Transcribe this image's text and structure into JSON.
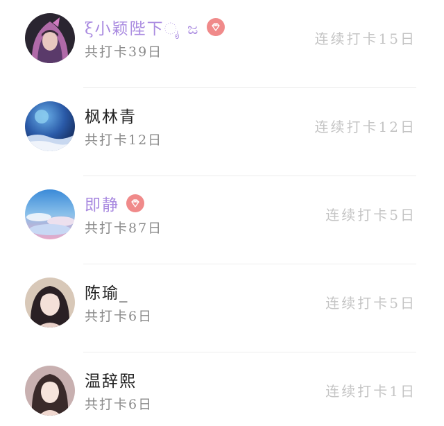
{
  "checkin_list": {
    "members": [
      {
        "name": "ξ小颖陛下ೖ ಜ",
        "vip": true,
        "total_checkin": "共打卡39日",
        "streak": "连续打卡15日",
        "avatar_icon": "avatar-hooded-girl"
      },
      {
        "name": "枫林青",
        "vip": false,
        "total_checkin": "共打卡12日",
        "streak": "连续打卡12日",
        "avatar_icon": "avatar-planet-night"
      },
      {
        "name": "即静",
        "vip": true,
        "total_checkin": "共打卡87日",
        "streak": "连续打卡5日",
        "avatar_icon": "avatar-sky-clouds"
      },
      {
        "name": "陈瑜_",
        "vip": false,
        "total_checkin": "共打卡6日",
        "streak": "连续打卡5日",
        "avatar_icon": "avatar-girl-portrait"
      },
      {
        "name": "温辞熙",
        "vip": false,
        "total_checkin": "共打卡6日",
        "streak": "连续打卡1日",
        "avatar_icon": "avatar-girl-portrait-2"
      }
    ]
  },
  "colors": {
    "vip_name": "#a98ae0",
    "vip_badge": "#f08a8a",
    "name": "#222222",
    "total": "#8a8a8a",
    "streak": "#c4c4c4"
  }
}
